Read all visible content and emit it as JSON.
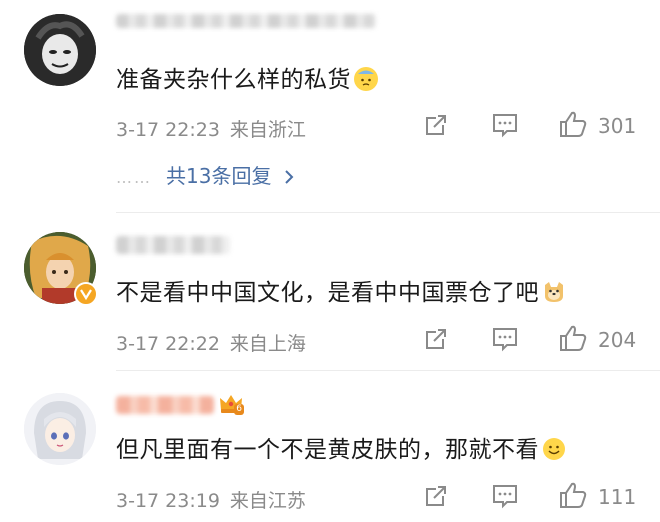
{
  "comments": [
    {
      "text": "准备夹杂什么样的私货",
      "emoji": "cold-sweat-emoji",
      "date": "3-17 22:23",
      "location": "来自浙江",
      "likes": "301",
      "replies_label": "共13条回复",
      "replies_dots": "……"
    },
    {
      "text": "不是看中中国文化，是看中中国票仓了吧",
      "emoji": "doge-emoji",
      "date": "3-17 22:22",
      "location": "来自上海",
      "likes": "204"
    },
    {
      "text": "但凡里面有一个不是黄皮肤的，那就不看",
      "emoji": "smile-emoji",
      "date": "3-17 23:19",
      "location": "来自江苏",
      "likes": "111",
      "badge": "6"
    }
  ],
  "icons": {
    "share": "share-icon",
    "comment": "comment-icon",
    "like": "thumbs-up-icon",
    "chevron": "chevron-right-icon"
  },
  "colors": {
    "link": "#4a6fa5",
    "meta": "#8a8a8a"
  }
}
